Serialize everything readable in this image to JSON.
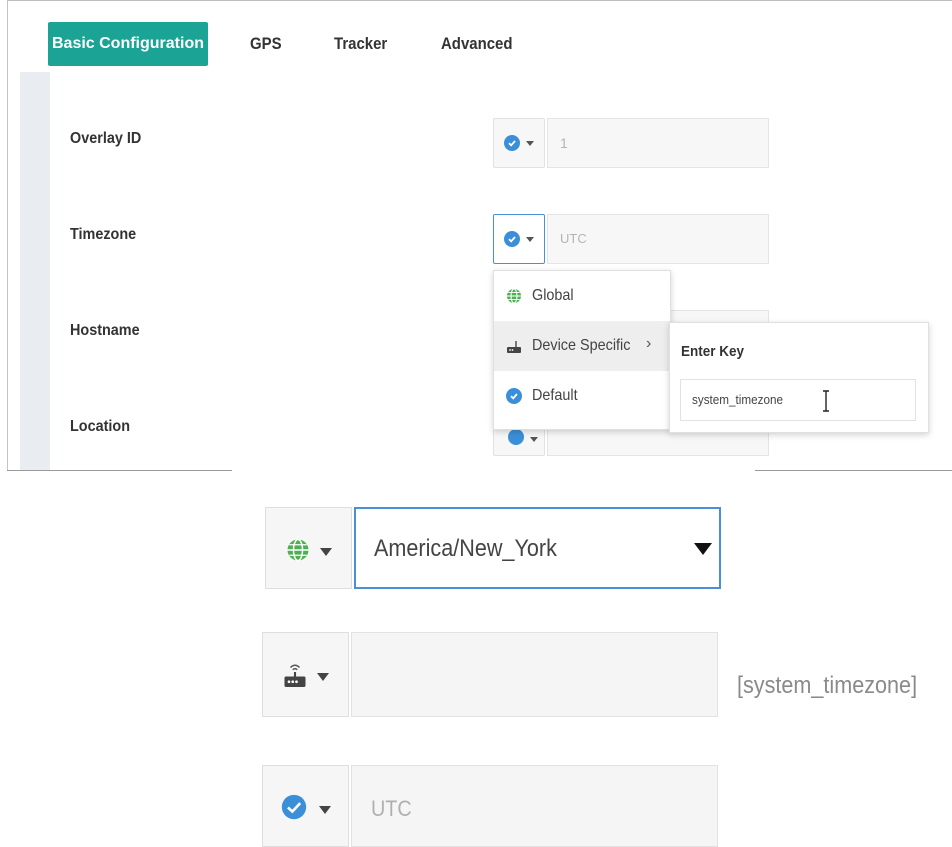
{
  "tabs": [
    {
      "label": "Basic Configuration",
      "active": true
    },
    {
      "label": "GPS",
      "active": false
    },
    {
      "label": "Tracker",
      "active": false
    },
    {
      "label": "Advanced",
      "active": false
    }
  ],
  "fields": {
    "overlay_id": {
      "label": "Overlay ID",
      "value": "1",
      "scope_icon": "check-icon"
    },
    "timezone": {
      "label": "Timezone",
      "value": "UTC",
      "scope_icon": "check-icon"
    },
    "hostname": {
      "label": "Hostname"
    },
    "location": {
      "label": "Location"
    }
  },
  "scope_menu": {
    "items": [
      {
        "label": "Global",
        "icon": "globe-icon"
      },
      {
        "label": "Device Specific",
        "icon": "router-icon",
        "has_submenu": true
      },
      {
        "label": "Default",
        "icon": "check-icon"
      }
    ],
    "submenu": {
      "title": "Enter Key",
      "input_value": "system_timezone"
    }
  },
  "zoomed_examples": {
    "global": {
      "value": "America/New_York",
      "icon": "globe-icon"
    },
    "device_specific": {
      "key_display": "[system_timezone]",
      "icon": "router-icon"
    },
    "default": {
      "value": "UTC",
      "icon": "check-icon"
    }
  },
  "colors": {
    "accent": "#1ba396",
    "check_blue": "#3b8fd8",
    "globe_green": "#4caf50",
    "focus_border": "#4a90d6"
  }
}
